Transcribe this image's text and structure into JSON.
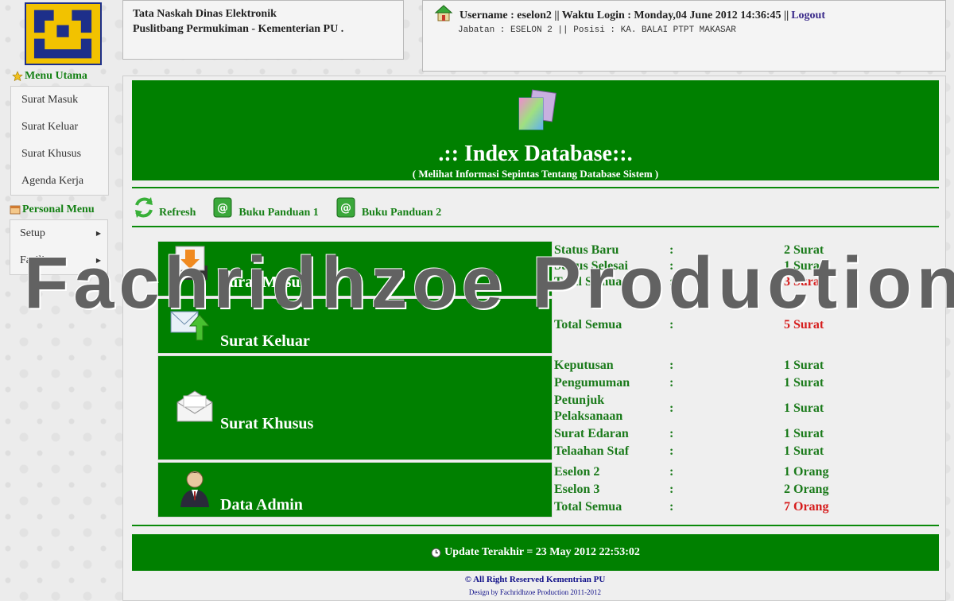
{
  "header": {
    "app_title": "Tata Naskah Dinas Elektronik",
    "org": "Puslitbang Permukiman - Kementerian PU .",
    "login_info": "Username : eselon2 || Waktu Login : Monday,04 June 2012 14:36:45 ||",
    "logout_label": "Logout",
    "jabatan": "Jabatan : ESELON 2 || Posisi : KA. BALAI PTPT MAKASAR"
  },
  "sidebar": {
    "menu_utama_title": "Menu Utama",
    "menu_utama_items": [
      "Surat Masuk",
      "Surat Keluar",
      "Surat Khusus",
      "Agenda Kerja"
    ],
    "personal_title": "Personal Menu",
    "personal_items": [
      "Setup",
      "Fasilitas"
    ]
  },
  "banner": {
    "title": ".:: Index Database::.",
    "subtitle": "( Melihat Informasi Sepintas Tentang Database Sistem )"
  },
  "toolbar": {
    "refresh": "Refresh",
    "panduan1": "Buku Panduan 1",
    "panduan2": "Buku Panduan 2"
  },
  "modules": {
    "surat_masuk": "Surat Masuk",
    "surat_keluar": "Surat Keluar",
    "surat_khusus": "Surat Khusus",
    "data_admin": "Data Admin"
  },
  "stats": {
    "colon": ":",
    "masuk": [
      {
        "label": "Status Baru",
        "value": "2 Surat"
      },
      {
        "label": "Status Selesai",
        "value": "1 Surat"
      },
      {
        "label": "Total Semua",
        "value": "3 Surat"
      }
    ],
    "keluar": [
      {
        "label": "Total Semua",
        "value": "5 Surat"
      }
    ],
    "khusus": [
      {
        "label": "Keputusan",
        "value": "1 Surat"
      },
      {
        "label": "Pengumuman",
        "value": "1 Surat"
      },
      {
        "label": "Petunjuk Pelaksanaan",
        "value": "1 Surat"
      },
      {
        "label": "Surat Edaran",
        "value": "1 Surat"
      },
      {
        "label": "Telaahan Staf",
        "value": "1 Surat"
      }
    ],
    "admin": [
      {
        "label": "Eselon 2",
        "value": "1 Orang"
      },
      {
        "label": "Eselon 3",
        "value": "2 Orang"
      },
      {
        "label": "Total Semua",
        "value": "7 Orang"
      }
    ]
  },
  "footer": {
    "update": "Update Terakhir = 23 May 2012 22:53:02",
    "copyright": "© All Right Reserved Kementrian PU",
    "design": "Design by Fachridhzoe Production 2011-2012"
  },
  "watermark": "Fachridhzoe Production",
  "colors": {
    "primary_green": "#008000",
    "total_red": "#d61c1c",
    "link_purple": "#3a2a8a"
  }
}
